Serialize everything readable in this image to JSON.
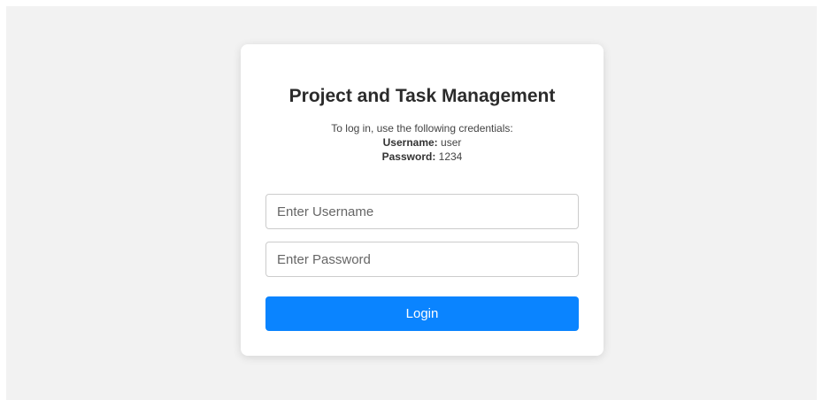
{
  "login": {
    "title": "Project and Task Management",
    "instructions": "To log in, use the following credentials:",
    "username_label": "Username:",
    "username_value": "user",
    "password_label": "Password:",
    "password_value": "1234",
    "username_placeholder": "Enter Username",
    "password_placeholder": "Enter Password",
    "username_input_value": "",
    "password_input_value": "",
    "button_label": "Login"
  },
  "colors": {
    "page_background": "#f2f2f2",
    "card_background": "#ffffff",
    "button": "#0a84ff",
    "button_text": "#ffffff"
  }
}
